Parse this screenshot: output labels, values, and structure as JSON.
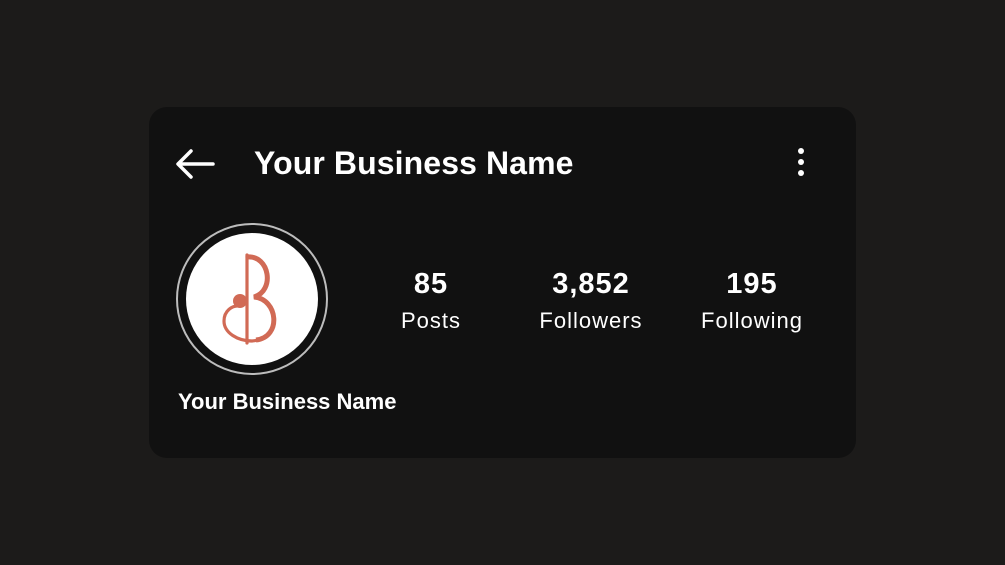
{
  "header": {
    "title": "Your Business Name",
    "back_icon": "arrow-left-icon",
    "more_icon": "vertical-dots-icon"
  },
  "profile": {
    "name": "Your Business Name",
    "logo_icon": "b-monogram-logo",
    "logo_color": "#d16a55"
  },
  "stats": [
    {
      "value": "85",
      "label": "Posts"
    },
    {
      "value": "3,852",
      "label": "Followers"
    },
    {
      "value": "195",
      "label": "Following"
    }
  ],
  "colors": {
    "page_background": "#1c1b1a",
    "card_background": "#111111",
    "text": "#ffffff",
    "avatar_ring": "#bdbdbd"
  }
}
